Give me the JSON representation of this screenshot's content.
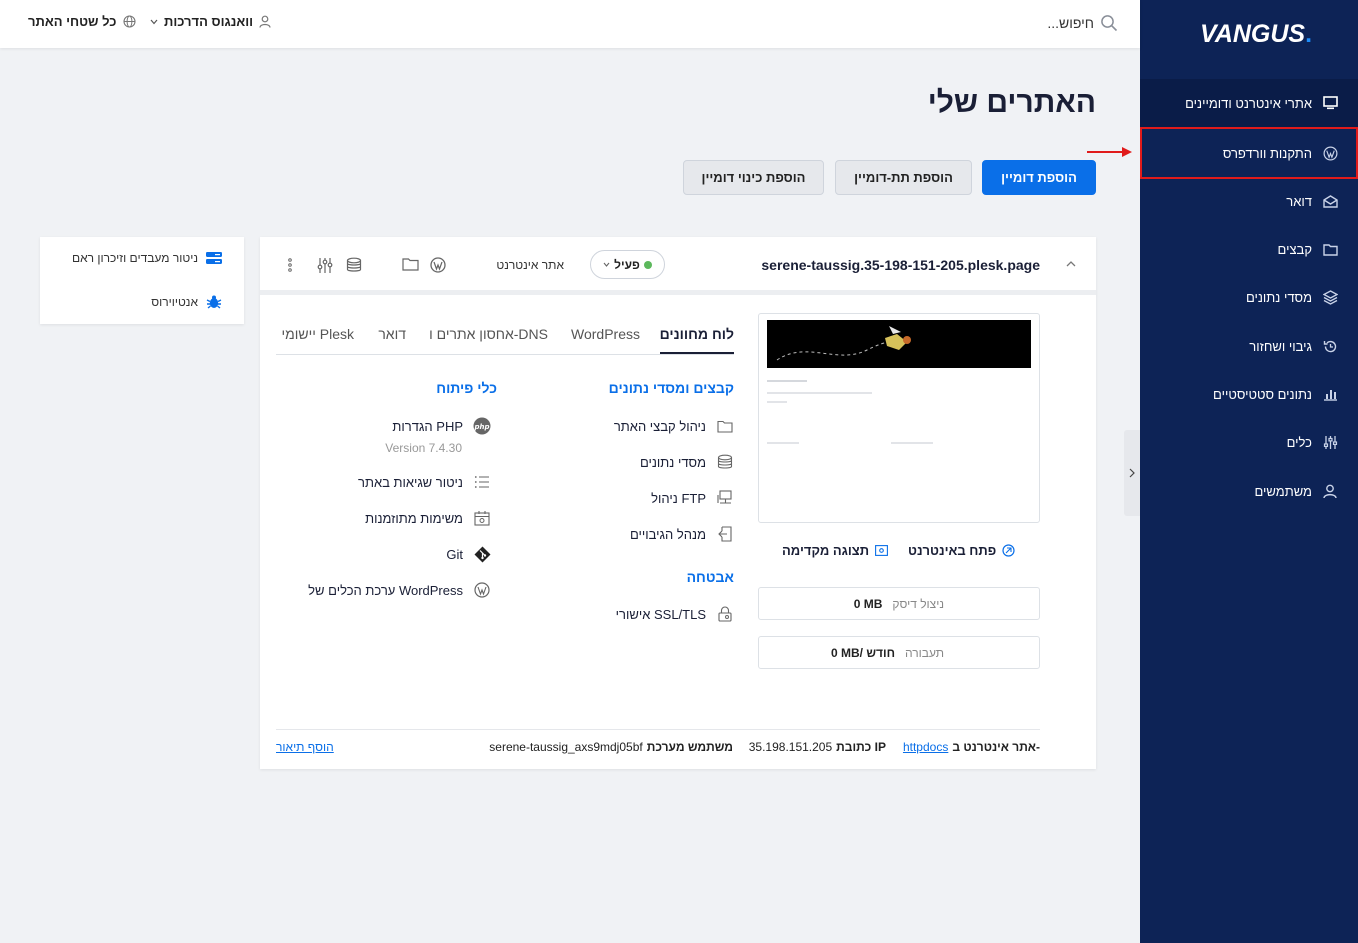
{
  "sidebar": {
    "logo": "VANGUS",
    "items": [
      {
        "label": "אתרי אינטרנט ודומיינים",
        "icon": "monitor-icon",
        "active": true
      },
      {
        "label": "התקנות וורדפרס",
        "icon": "wordpress-icon",
        "highlighted": true
      },
      {
        "label": "דואר",
        "icon": "mail-icon"
      },
      {
        "label": "קבצים",
        "icon": "folder-icon"
      },
      {
        "label": "מסדי נתונים",
        "icon": "database-icon"
      },
      {
        "label": "גיבוי ושחזור",
        "icon": "restore-icon"
      },
      {
        "label": "נתונים סטטיסטיים",
        "icon": "bar-chart-icon"
      },
      {
        "label": "כלים",
        "icon": "sliders-icon"
      },
      {
        "label": "משתמשים",
        "icon": "user-icon"
      }
    ]
  },
  "topbar": {
    "search_placeholder": "חיפוש...",
    "user_label": "וואנגוס הדרכות",
    "scope_label": "כל שטחי האתר"
  },
  "page": {
    "title": "האתרים שלי",
    "buttons": {
      "add_domain": "הוספת דומיין",
      "add_subdomain": "הוספת תת-דומיין",
      "add_alias": "הוספת כינוי דומיין"
    }
  },
  "side_widget": {
    "items": [
      {
        "label": "ניטור מעבדים וזיכרון ראם",
        "icon": "server-icon"
      },
      {
        "label": "אנטיוירוס",
        "icon": "bug-icon"
      }
    ]
  },
  "site": {
    "domain": "serene-taussig.35-198-151-205.plesk.page",
    "status": "פעיל",
    "status_color": "#5cb85c",
    "type": "אתר אינטרנט",
    "preview_actions": {
      "open": "פתח באינטרנט",
      "preview": "תצוגה מקדימה"
    },
    "disk_usage": {
      "label": "ניצול דיסק",
      "value": "0 MB"
    },
    "traffic": {
      "label": "תעבורה",
      "value": "0 MB/ חודש"
    },
    "tabs": [
      "לוח מחוונים",
      "WordPress",
      "אחסון אתרים ו-DNS",
      "דואר",
      "יישומי Plesk"
    ],
    "files_section": {
      "title": "קבצים ומסדי נתונים",
      "items": [
        "ניהול קבצי האתר",
        "מסדי נתונים",
        "ניהול FTP",
        "מנהל הגיבויים"
      ]
    },
    "security_section": {
      "title": "אבטחה",
      "items": [
        "אישורי SSL/TLS"
      ]
    },
    "dev_section": {
      "title": "כלי פיתוח",
      "php_label": "הגדרות PHP",
      "php_version": "Version 7.4.30",
      "items": [
        "ניטור שגיאות באתר",
        "משימות מתוזמנות",
        "Git",
        "ערכת הכלים של WordPress"
      ]
    },
    "footer": {
      "site_at_label": "אתר אינטרנט ב-",
      "site_at_link": "httpdocs",
      "ip_label": "כתובת IP",
      "ip_value": "35.198.151.205",
      "sysuser_label": "משתמש מערכת",
      "sysuser_value": "serene-taussig_axs9mdj05bf",
      "add_description": "הוסף תיאור"
    }
  },
  "colors": {
    "sidebar_bg": "#0d2356",
    "accent": "#0a6fe8",
    "highlight_border": "#e01b1b"
  }
}
